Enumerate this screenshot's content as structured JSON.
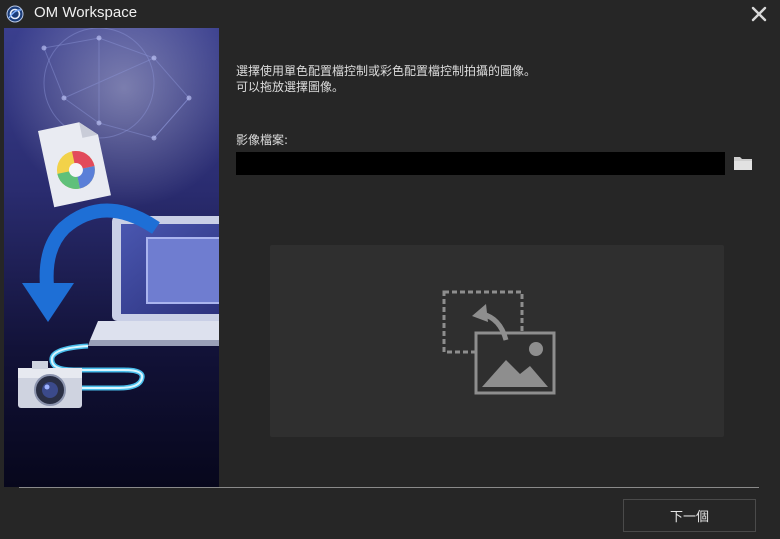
{
  "window": {
    "title": "OM Workspace",
    "app_icon": "om-workspace-logo-icon",
    "close_icon": "close-icon"
  },
  "main": {
    "instruction_line1": "選擇使用單色配置檔控制或彩色配置檔控制拍攝的圖像。",
    "instruction_line2": "可以拖放選擇圖像。",
    "file_label": "影像檔案:",
    "file_value": "",
    "browse_icon": "folder-icon",
    "dropzone_icon": "image-drop-icon"
  },
  "footer": {
    "next_label": "下一個"
  },
  "colors": {
    "background": "#262626",
    "dropzone": "#2f2f2f",
    "input": "#000000",
    "accent_blue": "#1e6fd6"
  }
}
